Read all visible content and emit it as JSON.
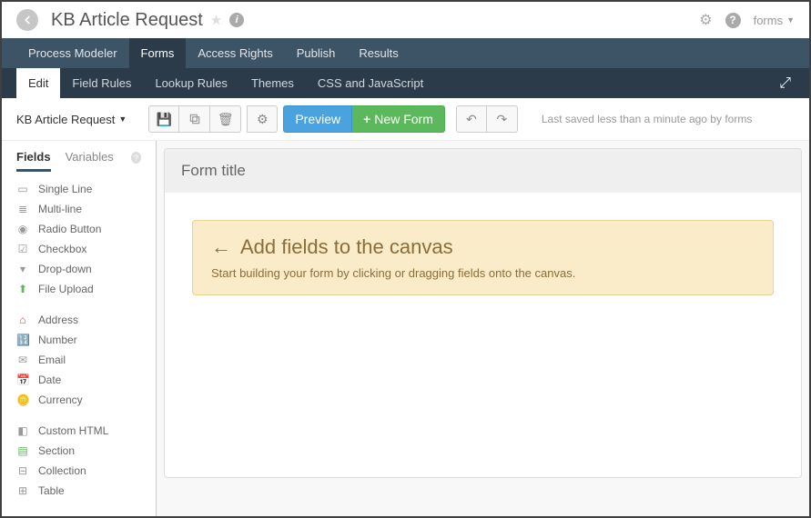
{
  "header": {
    "title": "KB Article Request",
    "user": "forms"
  },
  "nav1": [
    "Process Modeler",
    "Forms",
    "Access Rights",
    "Publish",
    "Results"
  ],
  "nav2": [
    "Edit",
    "Field Rules",
    "Lookup Rules",
    "Themes",
    "CSS and JavaScript"
  ],
  "toolbar": {
    "form_name": "KB Article Request",
    "preview": "Preview",
    "new_form": "New Form",
    "status": "Last saved less than a minute ago by forms"
  },
  "sidebar": {
    "tabs": [
      "Fields",
      "Variables"
    ],
    "fields": [
      "Single Line",
      "Multi-line",
      "Radio Button",
      "Checkbox",
      "Drop-down",
      "File Upload",
      "Address",
      "Number",
      "Email",
      "Date",
      "Currency",
      "Custom HTML",
      "Section",
      "Collection",
      "Table"
    ]
  },
  "canvas": {
    "title": "Form title",
    "hint_title": "Add fields to the canvas",
    "hint_body": "Start building your form by clicking or dragging fields onto the canvas."
  }
}
